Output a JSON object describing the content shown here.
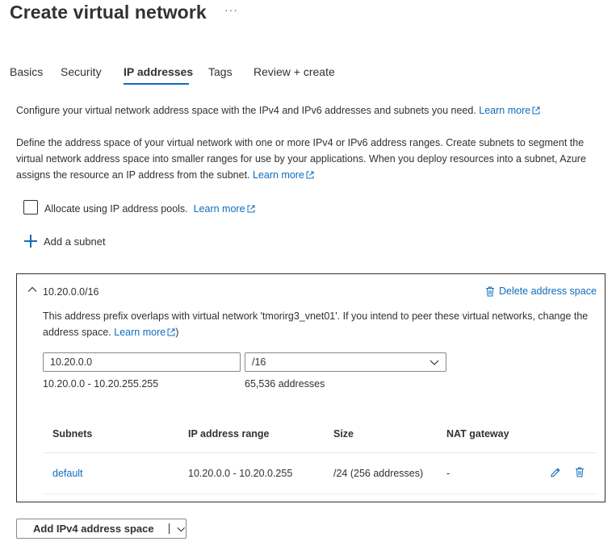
{
  "page": {
    "title": "Create virtual network",
    "more_label": "···"
  },
  "tabs": [
    {
      "label": "Basics",
      "active": false
    },
    {
      "label": "Security",
      "active": false
    },
    {
      "label": "IP addresses",
      "active": true
    },
    {
      "label": "Tags",
      "active": false
    },
    {
      "label": "Review + create",
      "active": false
    }
  ],
  "intro": {
    "text": "Configure your virtual network address space with the IPv4 and IPv6 addresses and subnets you need.",
    "link": "Learn more"
  },
  "description": {
    "text": "Define the address space of your virtual network with one or more IPv4 or IPv6 address ranges. Create subnets to segment the virtual network address space into smaller ranges for use by your applications. When you deploy resources into a subnet, Azure assigns the resource an IP address from the subnet.",
    "link": "Learn more"
  },
  "ip_pools": {
    "label": "Allocate using IP address pools.",
    "link": "Learn more",
    "checked": false
  },
  "add_subnet": {
    "label": "Add a subnet"
  },
  "address_space": {
    "prefix": "10.20.0.0/16",
    "delete_label": "Delete address space",
    "warning_text": "This address prefix overlaps with virtual network 'tmorirg3_vnet01'. If you intend to peer these virtual networks, change the address space.",
    "warning_link": "Learn more",
    "warning_suffix": ")",
    "address_value": "10.20.0.0",
    "mask_value": "/16",
    "range_text": "10.20.0.0 - 10.20.255.255",
    "count_text": "65,536 addresses",
    "table": {
      "headers": [
        "Subnets",
        "IP address range",
        "Size",
        "NAT gateway"
      ],
      "rows": [
        {
          "name": "default",
          "range": "10.20.0.0 - 10.20.0.255",
          "size": "/24 (256 addresses)",
          "nat": "-"
        }
      ]
    }
  },
  "add_space_button": {
    "label": "Add IPv4 address space"
  },
  "colors": {
    "accent": "#0f6cbd",
    "text": "#323130",
    "border": "#8a8886"
  }
}
